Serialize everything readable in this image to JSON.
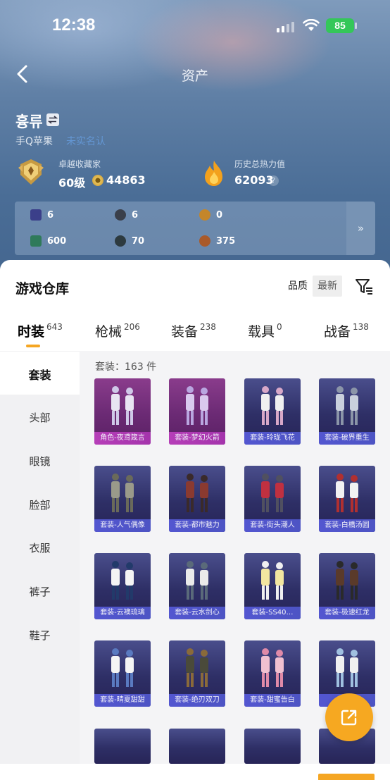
{
  "status_bar": {
    "time": "12:38",
    "battery": "85"
  },
  "nav": {
    "title": "资产"
  },
  "profile": {
    "name": "흉류",
    "platform": "手Q苹果",
    "platform_tag": "未实名认",
    "collector_label": "卓越收藏家",
    "level": "60级",
    "coins": "44863",
    "heat_label": "历史总热力值",
    "heat": "62093",
    "help": "?"
  },
  "stats": {
    "values": [
      "6",
      "6",
      "0",
      "600",
      "70",
      "375"
    ],
    "more": "»"
  },
  "warehouse": {
    "title": "游戏仓库",
    "sort_quality": "品质",
    "sort_newest": "最新",
    "tabs": [
      {
        "label": "时装",
        "count": "643"
      },
      {
        "label": "枪械",
        "count": "206"
      },
      {
        "label": "装备",
        "count": "238"
      },
      {
        "label": "载具",
        "count": "0"
      },
      {
        "label": "战备",
        "count": "138"
      }
    ],
    "sidebar": [
      "套装",
      "头部",
      "眼镜",
      "脸部",
      "衣服",
      "裤子",
      "鞋子"
    ],
    "count_label": "套装：163 件",
    "items": [
      "角色-夜鸢箴言",
      "套装-梦幻火箭",
      "套装-玲珑飞花",
      "套装-破界重生",
      "套装-人气偶像",
      "套装-都市魅力",
      "套装-街头潮人",
      "套装-白橋汤圆",
      "套装-云襖琉璃",
      "套装-云水剑心",
      "套装-SS40…",
      "套装-极速红龙",
      "套装-晴夏甜甜",
      "套装-绝刃双刀",
      "套装-甜蜜告白",
      "套装-"
    ]
  },
  "colors": {
    "accent": "#f5a623",
    "legendary": "#b63eb8",
    "epic": "#5356d0",
    "battery": "#34c759"
  },
  "icons": [
    "back-arrow-icon",
    "swap-icon",
    "medal-icon",
    "coin-icon",
    "flame-icon",
    "filter-icon",
    "share-icon"
  ]
}
